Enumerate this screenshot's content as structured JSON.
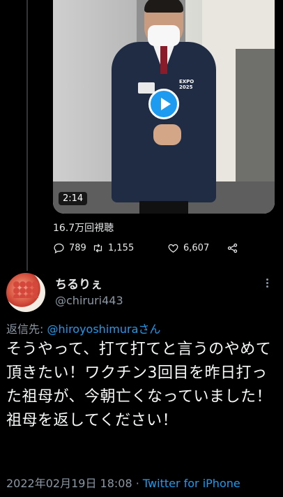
{
  "video": {
    "duration": "2:14",
    "badge_text": "EXPO\n2025"
  },
  "stats": {
    "views": "16.7万回視聴",
    "replies": "789",
    "retweets": "1,155",
    "likes": "6,607"
  },
  "icons": {
    "reply": "reply-icon",
    "retweet": "retweet-icon",
    "like": "heart-icon",
    "share": "share-icon",
    "more": "more-vertical-icon",
    "play": "play-icon"
  },
  "colors": {
    "background": "#000000",
    "accent": "#1d9bf0",
    "muted": "#8b98a5",
    "text": "#e7e9ea"
  },
  "reply_tweet": {
    "display_name": "ちるりぇ",
    "handle": "@chiruri443",
    "reply_prefix": "返信先: ",
    "reply_mention": "@hiroyoshimura",
    "reply_suffix": "さん",
    "text": "そうやって、打て打てと言うのやめて頂きたい！ワクチン3回目を昨日打った祖母が、今朝亡くなっていました！祖母を返してください！",
    "timestamp": "2022年02月19日 18:08",
    "separator": " · ",
    "client": "Twitter for iPhone"
  }
}
